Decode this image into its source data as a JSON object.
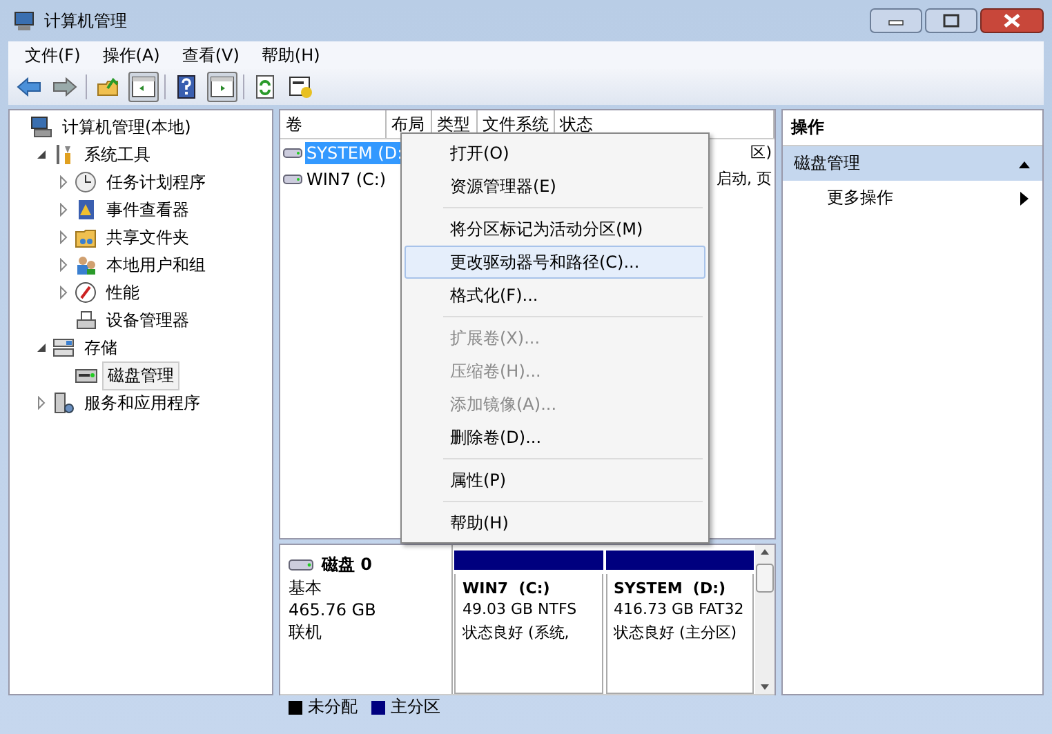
{
  "window": {
    "title": "计算机管理"
  },
  "menu_bar": [
    "文件(F)",
    "操作(A)",
    "查看(V)",
    "帮助(H)"
  ],
  "toolbar": [
    {
      "kind": "back"
    },
    {
      "kind": "forward"
    },
    {
      "kind": "sep"
    },
    {
      "kind": "up"
    },
    {
      "kind": "pane",
      "pressed": true
    },
    {
      "kind": "sep"
    },
    {
      "kind": "help"
    },
    {
      "kind": "pane2",
      "pressed": true
    },
    {
      "kind": "sep"
    },
    {
      "kind": "refresh"
    },
    {
      "kind": "props"
    }
  ],
  "tree": [
    {
      "label": "计算机管理(本地)",
      "kind": "computer",
      "children": [
        {
          "label": "系统工具",
          "kind": "tools",
          "expanded": true,
          "children": [
            {
              "label": "任务计划程序",
              "kind": "clock",
              "expanded": false
            },
            {
              "label": "事件查看器",
              "kind": "log",
              "expanded": false
            },
            {
              "label": "共享文件夹",
              "kind": "folder",
              "expanded": false
            },
            {
              "label": "本地用户和组",
              "kind": "users",
              "expanded": false
            },
            {
              "label": "性能",
              "kind": "gauge",
              "expanded": false
            },
            {
              "label": "设备管理器",
              "kind": "device"
            }
          ]
        },
        {
          "label": "存储",
          "kind": "storage",
          "expanded": true,
          "children": [
            {
              "label": "磁盘管理",
              "kind": "disk",
              "selected": true
            }
          ]
        },
        {
          "label": "服务和应用程序",
          "kind": "services",
          "expanded": false
        }
      ]
    }
  ],
  "table": {
    "columns": [
      "卷",
      "布局",
      "类型",
      "文件系统",
      "状态"
    ],
    "rows": [
      {
        "volume": "SYSTEM (D:",
        "status": "区)",
        "selected": true
      },
      {
        "volume": "WIN7 (C:)",
        "status": "启动, 页",
        "selected": false
      }
    ]
  },
  "context_menu": [
    {
      "label": "打开(O)",
      "kind": "item",
      "disabled": false,
      "selected": false
    },
    {
      "label": "资源管理器(E)",
      "kind": "item",
      "disabled": false,
      "selected": false
    },
    {
      "kind": "sep"
    },
    {
      "label": "将分区标记为活动分区(M)",
      "kind": "item",
      "disabled": false,
      "selected": false
    },
    {
      "label": "更改驱动器号和路径(C)...",
      "kind": "item",
      "disabled": false,
      "selected": true
    },
    {
      "label": "格式化(F)...",
      "kind": "item",
      "disabled": false,
      "selected": false
    },
    {
      "kind": "sep"
    },
    {
      "label": "扩展卷(X)...",
      "kind": "item",
      "disabled": true,
      "selected": false
    },
    {
      "label": "压缩卷(H)...",
      "kind": "item",
      "disabled": true,
      "selected": false
    },
    {
      "label": "添加镜像(A)...",
      "kind": "item",
      "disabled": true,
      "selected": false
    },
    {
      "label": "删除卷(D)...",
      "kind": "item",
      "disabled": false,
      "selected": false
    },
    {
      "kind": "sep"
    },
    {
      "label": "属性(P)",
      "kind": "item",
      "disabled": false,
      "selected": false
    },
    {
      "kind": "sep"
    },
    {
      "label": "帮助(H)",
      "kind": "item",
      "disabled": false,
      "selected": false
    }
  ],
  "disk": {
    "name": "磁盘 0",
    "type": "基本",
    "size": "465.76 GB",
    "state": "联机",
    "partitions": [
      {
        "name": "WIN7  (C:)",
        "size": "49.03 GB NTFS",
        "status": "状态良好 (系统,",
        "color": "#00007f"
      },
      {
        "name": "SYSTEM  (D:)",
        "size": "416.73 GB FAT32",
        "status": "状态良好 (主分区)",
        "color": "#00007f"
      }
    ]
  },
  "legend": [
    {
      "label": "未分配",
      "color": "#000000"
    },
    {
      "label": "主分区",
      "color": "#00007f"
    }
  ],
  "actions": {
    "title": "操作",
    "section": {
      "label": "磁盘管理",
      "expanded": true
    },
    "items": [
      "更多操作"
    ]
  }
}
